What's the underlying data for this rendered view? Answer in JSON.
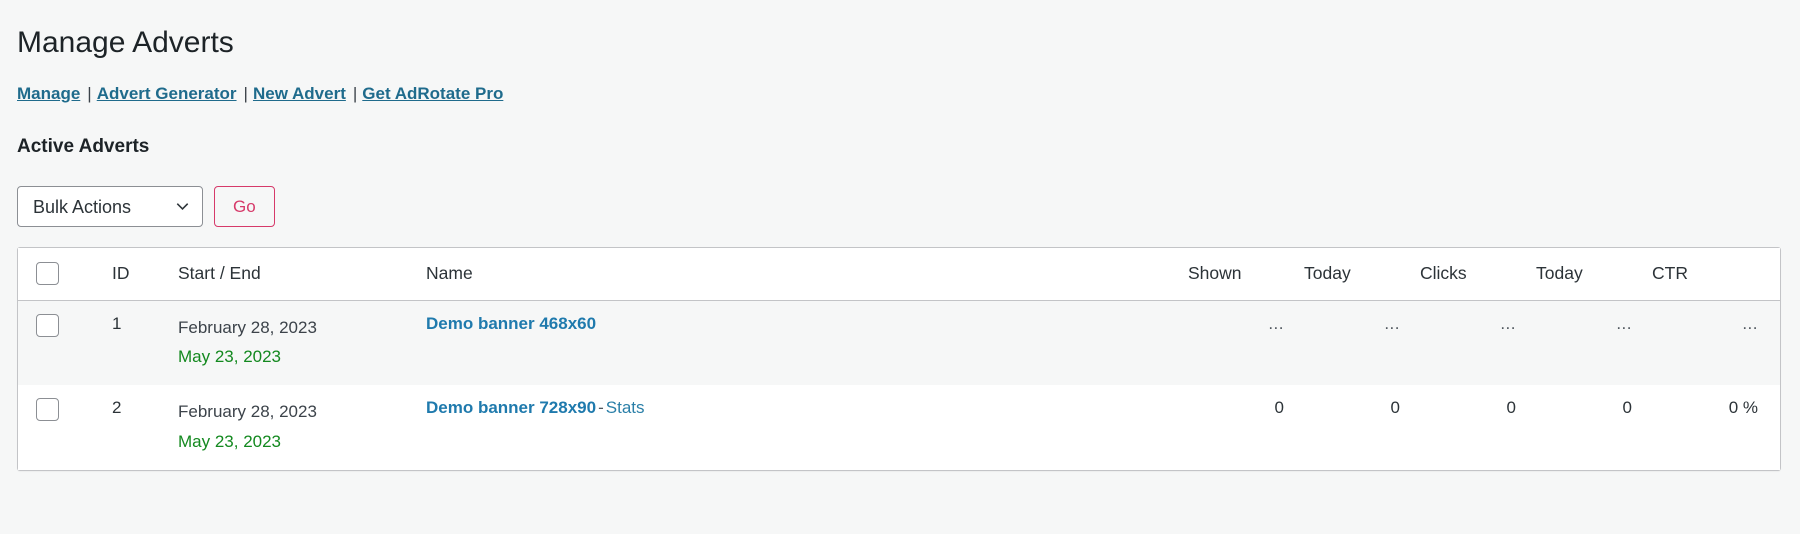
{
  "page": {
    "title": "Manage Adverts",
    "section_heading": "Active Adverts"
  },
  "subnav": {
    "items": [
      {
        "label": "Manage"
      },
      {
        "label": "Advert Generator"
      },
      {
        "label": "New Advert"
      },
      {
        "label": "Get AdRotate Pro"
      }
    ],
    "separator": "|"
  },
  "toolbar": {
    "bulk_actions_selected": "Bulk Actions",
    "bulk_actions_options": [
      "Bulk Actions"
    ],
    "go_label": "Go",
    "chevron_icon": "chevron-down-icon"
  },
  "table": {
    "headers": {
      "select_all": "",
      "id": "ID",
      "dates": "Start / End",
      "name": "Name",
      "shown": "Shown",
      "shown_today": "Today",
      "clicks": "Clicks",
      "clicks_today": "Today",
      "ctr": "CTR"
    },
    "rows": [
      {
        "id": "1",
        "start_date": "February 28, 2023",
        "end_date": "May 23, 2023",
        "name": "Demo banner 468x60",
        "has_stats": false,
        "dash": "",
        "stats_label": "",
        "shown": "...",
        "shown_today": "...",
        "clicks": "...",
        "clicks_today": "...",
        "ctr": "..."
      },
      {
        "id": "2",
        "start_date": "February 28, 2023",
        "end_date": "May 23, 2023",
        "name": "Demo banner 728x90",
        "has_stats": true,
        "dash": "-",
        "stats_label": "Stats",
        "shown": "0",
        "shown_today": "0",
        "clicks": "0",
        "clicks_today": "0",
        "ctr": "0 %"
      }
    ]
  },
  "colors": {
    "link": "#1f6b8c",
    "name_link": "#1f7aad",
    "end_date_green": "#13891f",
    "go_accent": "#d63a6a",
    "page_bg": "#f6f7f7"
  }
}
